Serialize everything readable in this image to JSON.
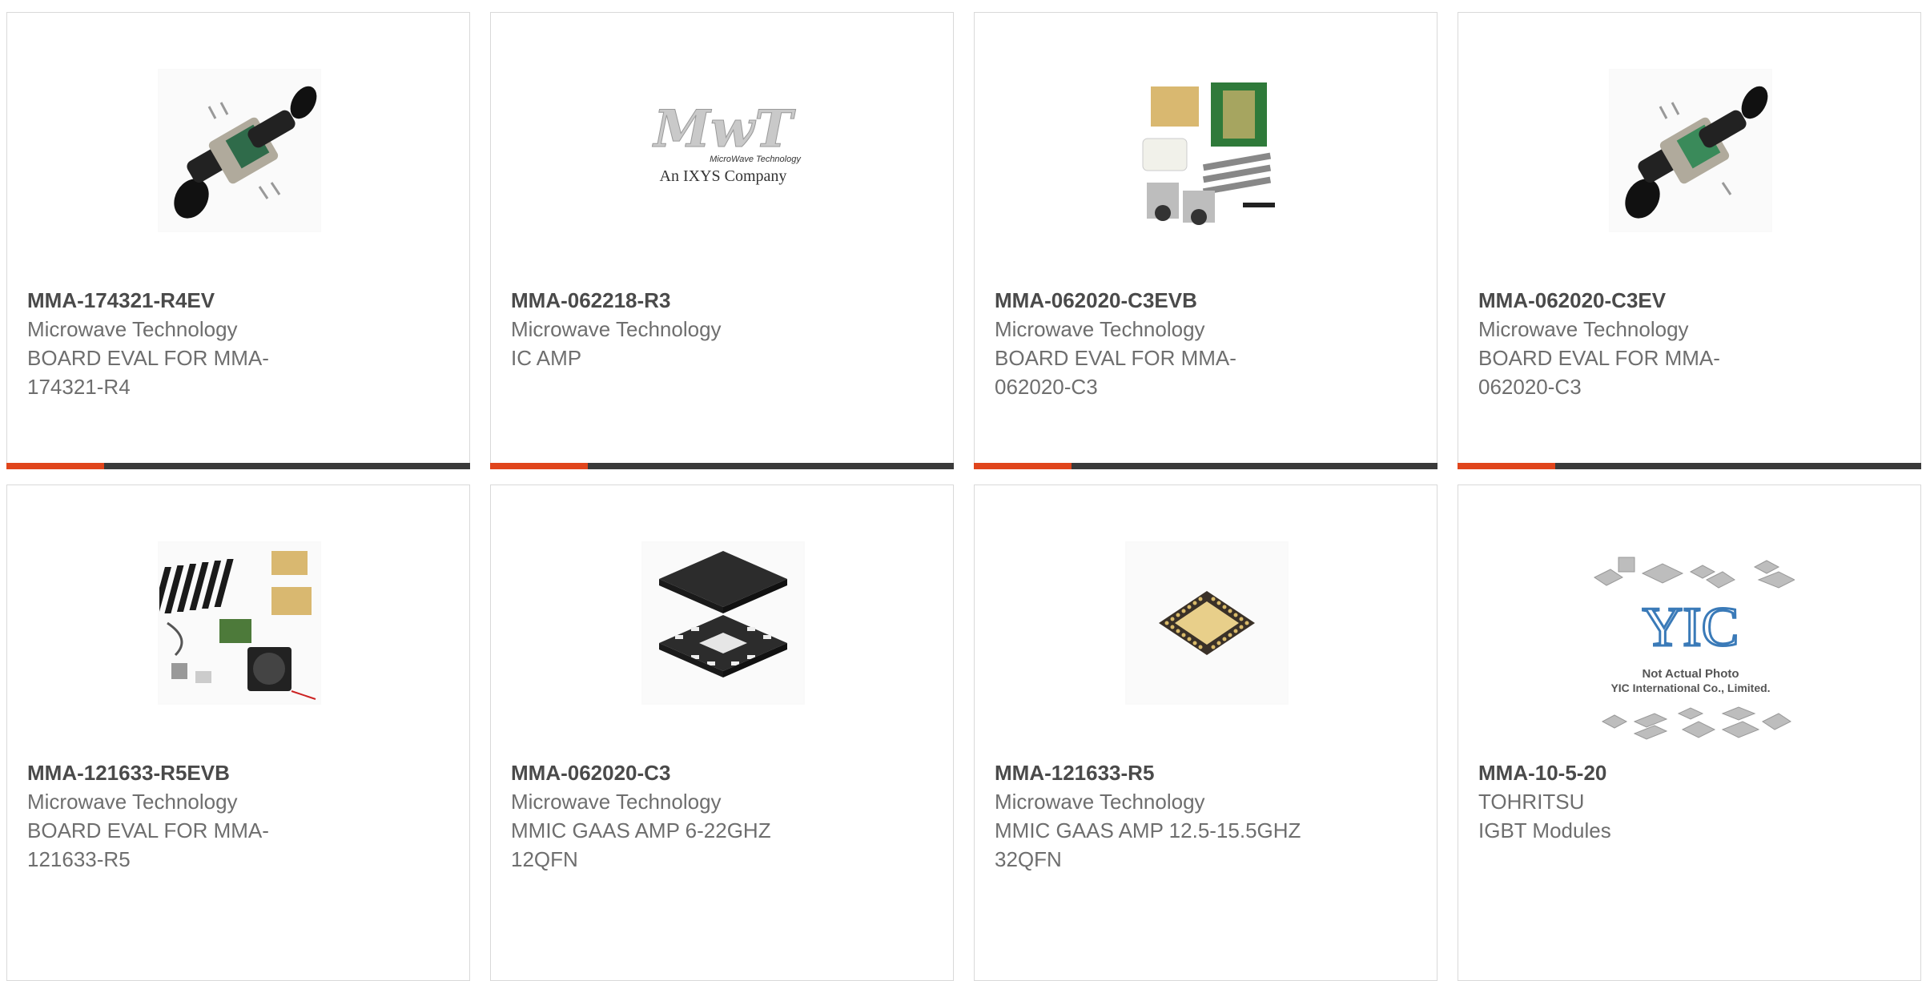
{
  "colors": {
    "accent": "#e0451c",
    "bar_dark": "#3a3a3a",
    "border": "#d9d9d9",
    "title_text": "#4a4a4a",
    "body_text": "#6e6e6e"
  },
  "products": [
    {
      "part_number": "MMA-174321-R4EV",
      "manufacturer": "Microwave Technology",
      "description": "BOARD EVAL FOR MMA-174321-R4",
      "image_icon": "eval-board-connector-icon",
      "progress": 0.21
    },
    {
      "part_number": "MMA-062218-R3",
      "manufacturer": "Microwave Technology",
      "description": "IC AMP",
      "image_icon": "mwt-logo-icon",
      "logo_text": "MwT",
      "logo_tagline": "MicroWave Technology",
      "logo_subtitle": "An IXYS Company",
      "progress": 0.21
    },
    {
      "part_number": "MMA-062020-C3EVB",
      "manufacturer": "Microwave Technology",
      "description": "BOARD EVAL FOR MMA-062020-C3",
      "image_icon": "eval-kit-parts-icon",
      "progress": 0.21
    },
    {
      "part_number": "MMA-062020-C3EV",
      "manufacturer": "Microwave Technology",
      "description": "BOARD EVAL FOR MMA-062020-C3",
      "image_icon": "eval-board-connector-icon",
      "progress": 0.21
    },
    {
      "part_number": "MMA-121633-R5EVB",
      "manufacturer": "Microwave Technology",
      "description": "BOARD EVAL FOR MMA-121633-R5",
      "image_icon": "heatsink-kit-icon",
      "progress": 0
    },
    {
      "part_number": "MMA-062020-C3",
      "manufacturer": "Microwave Technology",
      "description": "MMIC GAAS AMP 6-22GHZ 12QFN",
      "image_icon": "qfn-chip-icon",
      "progress": 0
    },
    {
      "part_number": "MMA-121633-R5",
      "manufacturer": "Microwave Technology",
      "description": "MMIC GAAS AMP 12.5-15.5GHZ 32QFN",
      "image_icon": "qfn32-chip-icon",
      "progress": 0
    },
    {
      "part_number": "MMA-10-5-20",
      "manufacturer": "TOHRITSU",
      "description": "IGBT Modules",
      "image_icon": "yic-placeholder-icon",
      "logo_text": "YIC",
      "placeholder_line1": "Not Actual Photo",
      "placeholder_line2": "YIC International Co., Limited.",
      "progress": 0
    }
  ]
}
